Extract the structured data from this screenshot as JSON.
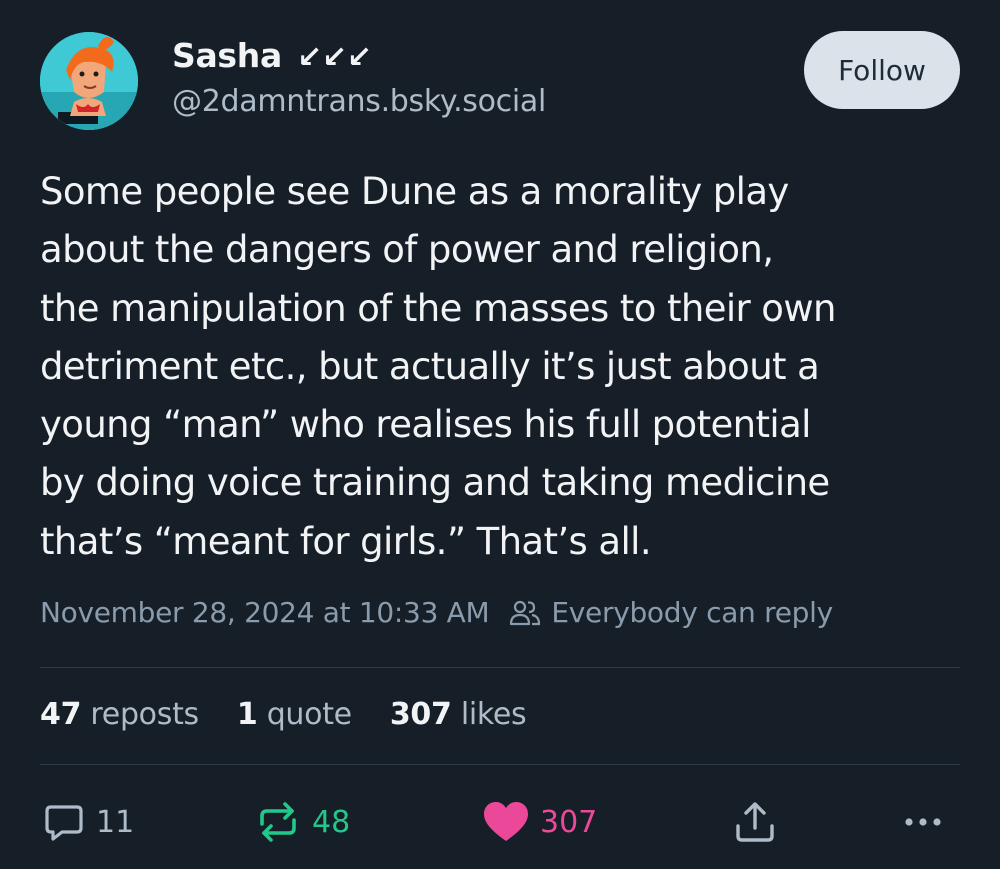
{
  "author": {
    "display_name": "Sasha",
    "name_badge": "↙↙↙",
    "handle": "@2damntrans.bsky.social"
  },
  "follow_label": "Follow",
  "post": {
    "text": "Some people see Dune as a morality play\nabout the dangers of power and religion,\nthe manipulation of the masses to their own\ndetriment etc., but actually it’s just about a\nyoung “man” who realises his full potential\nby doing voice training and taking medicine\nthat’s “meant for girls.” That’s all.",
    "timestamp": "November 28, 2024 at 10:33 AM",
    "reply_setting": "Everybody can reply"
  },
  "stats": {
    "reposts_count": "47",
    "reposts_label": "reposts",
    "quotes_count": "1",
    "quotes_label": "quote",
    "likes_count": "307",
    "likes_label": "likes"
  },
  "actions": {
    "reply_count": "11",
    "repost_count": "48",
    "like_count": "307"
  },
  "colors": {
    "background": "#161e27",
    "follow_button": "#dce2ea",
    "repost_active": "#22c88a",
    "like_active": "#ec4899"
  },
  "icons": {
    "reply": "speech-bubble-icon",
    "repost": "repost-arrows-icon",
    "like": "heart-icon",
    "share": "share-icon",
    "more": "ellipsis-icon",
    "reply_setting": "people-icon"
  }
}
